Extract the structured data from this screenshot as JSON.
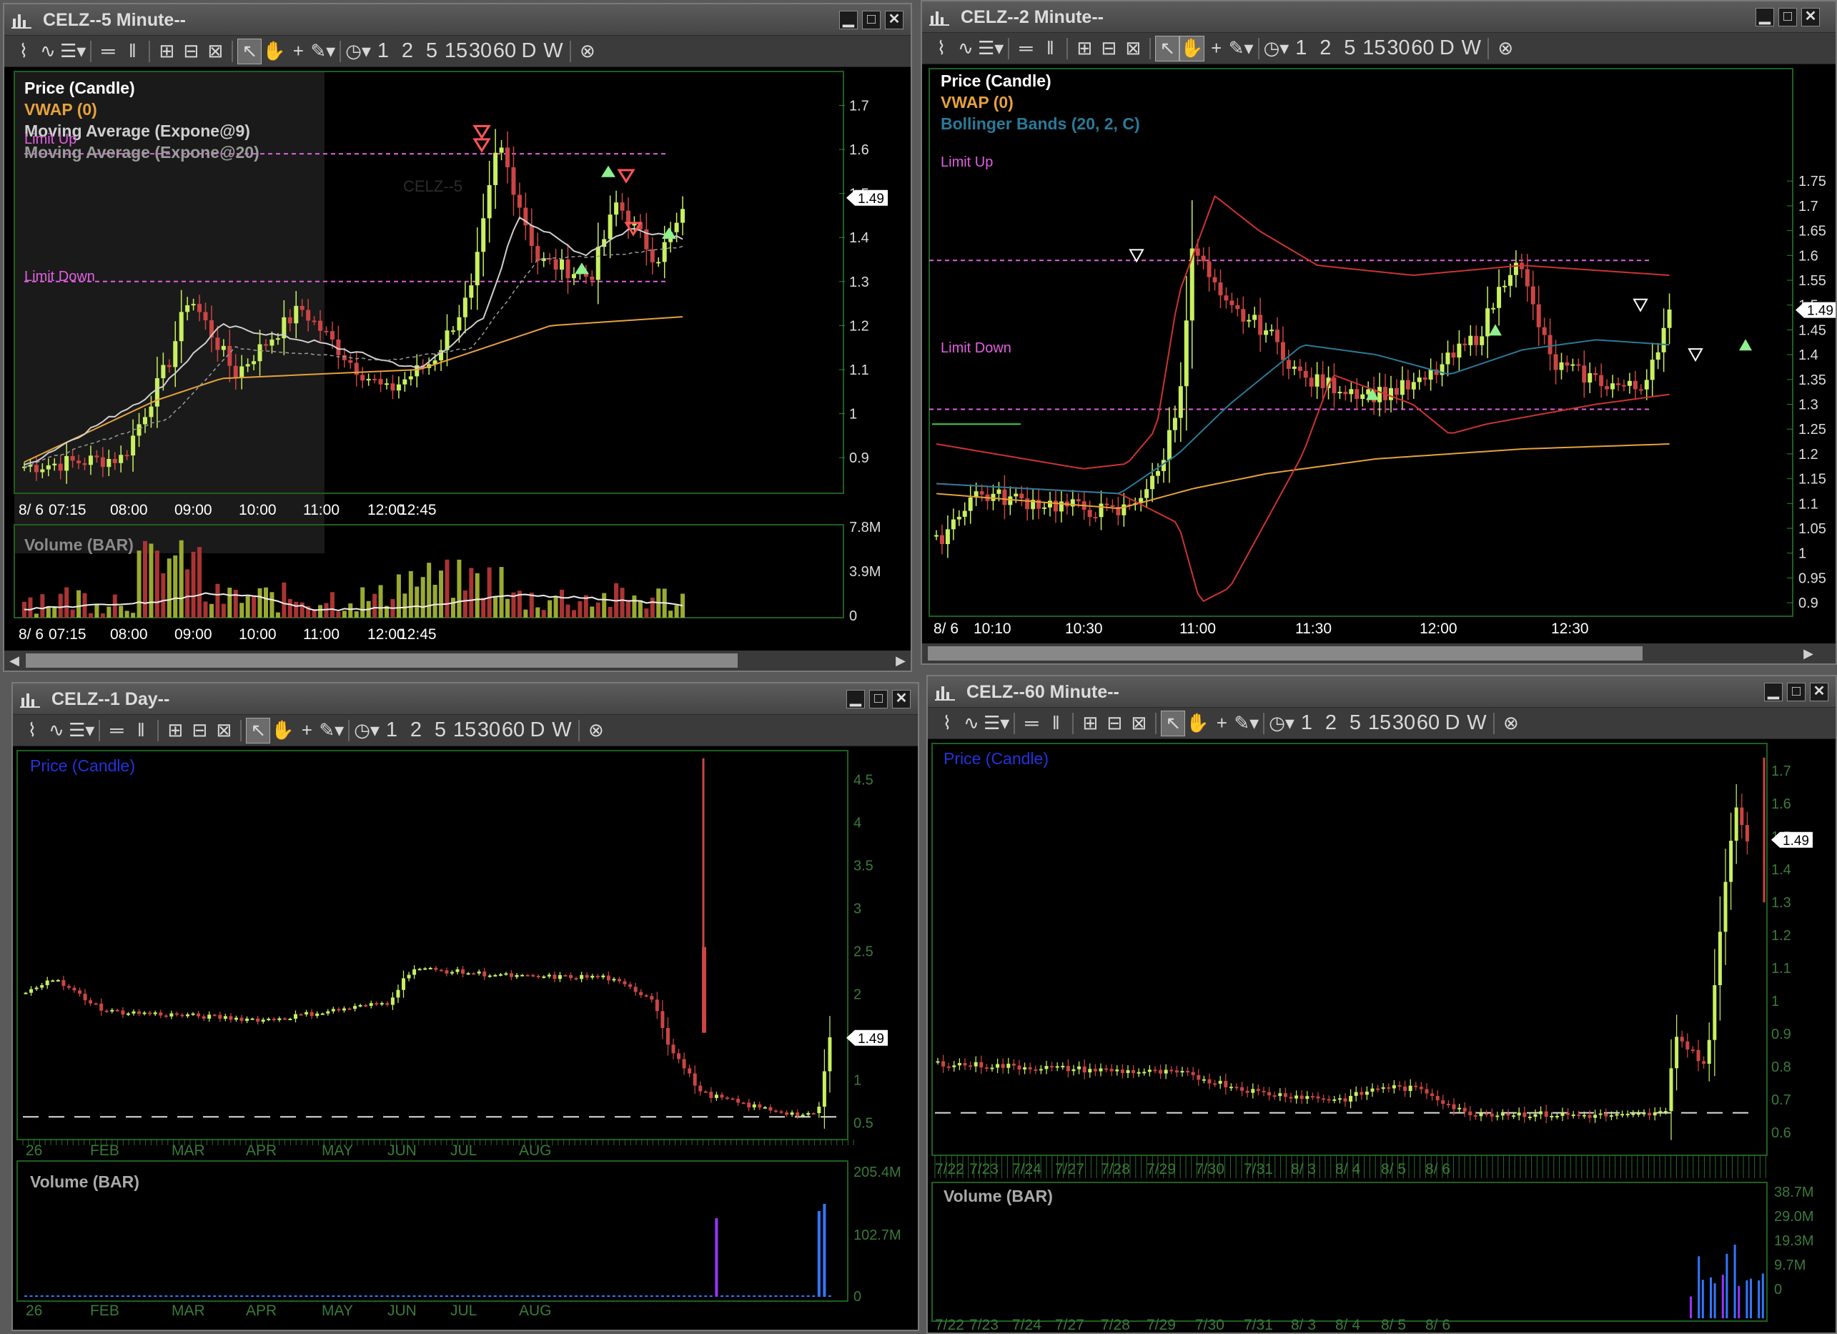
{
  "windows": [
    {
      "id": "w5min",
      "title": "CELZ--5 Minute--",
      "labels": {
        "price": "Price (Candle)",
        "vwap": "VWAP (0)",
        "ma9": "Moving Average (Expone@9)",
        "ma20": "Moving Average (Expone@20)",
        "limit_up": "Limit Up",
        "limit_down": "Limit Down",
        "watermark": "CELZ--5",
        "volume": "Volume (BAR)"
      },
      "price_axis": [
        "1.7",
        "1.6",
        "1.5",
        "1.4",
        "1.3",
        "1.2",
        "1.1",
        "1",
        "0.9"
      ],
      "last_price": "1.49",
      "volume_axis": [
        "7.8M",
        "3.9M",
        "0"
      ],
      "time_axis": [
        "8/ 6",
        "07:15",
        "08:00",
        "09:00",
        "10:00",
        "11:00",
        "12:00",
        "12:45"
      ]
    },
    {
      "id": "w2min",
      "title": "CELZ--2 Minute--",
      "labels": {
        "price": "Price (Candle)",
        "vwap": "VWAP (0)",
        "bb": "Bollinger Bands (20, 2, C)",
        "limit_up": "Limit Up",
        "limit_down": "Limit Down"
      },
      "price_axis": [
        "1.75",
        "1.7",
        "1.65",
        "1.6",
        "1.55",
        "1.5",
        "1.45",
        "1.4",
        "1.35",
        "1.3",
        "1.25",
        "1.2",
        "1.15",
        "1.1",
        "1.05",
        "1",
        "0.95",
        "0.9"
      ],
      "last_price": "1.49",
      "time_axis": [
        "8/ 6",
        "10:10",
        "10:30",
        "11:00",
        "11:30",
        "12:00",
        "12:30"
      ]
    },
    {
      "id": "w1day",
      "title": "CELZ--1 Day--",
      "labels": {
        "price": "Price (Candle)",
        "volume": "Volume (BAR)"
      },
      "price_axis": [
        "4.5",
        "4",
        "3.5",
        "3",
        "2.5",
        "2",
        "1.5",
        "1",
        "0.5"
      ],
      "last_price": "1.49",
      "volume_axis": [
        "205.4M",
        "102.7M",
        "0"
      ],
      "time_axis": [
        "26",
        "FEB",
        "MAR",
        "APR",
        "MAY",
        "JUN",
        "JUL",
        "AUG"
      ]
    },
    {
      "id": "w60min",
      "title": "CELZ--60 Minute--",
      "labels": {
        "price": "Price (Candle)",
        "volume": "Volume (BAR)"
      },
      "price_axis": [
        "1.7",
        "1.6",
        "1.5",
        "1.4",
        "1.3",
        "1.2",
        "1.1",
        "1",
        "0.9",
        "0.8",
        "0.7",
        "0.6"
      ],
      "last_price": "1.49",
      "volume_axis": [
        "38.7M",
        "29.0M",
        "19.3M",
        "9.7M",
        "0"
      ],
      "time_axis": [
        "7/22",
        "7/23",
        "7/24",
        "7/27",
        "7/28",
        "7/29",
        "7/30",
        "7/31",
        "8/ 3",
        "8/ 4",
        "8/ 5",
        "8/ 6"
      ]
    }
  ],
  "toolbar": {
    "periods": [
      "1",
      "2",
      "5",
      "15",
      "30",
      "60",
      "D",
      "W"
    ]
  },
  "colors": {
    "up": "#c8f060",
    "down": "#cc4444",
    "vwap": "#e6a23c",
    "limit": "#e060e0",
    "bb": "#cc3333",
    "bbmid": "#2a7a99"
  }
}
